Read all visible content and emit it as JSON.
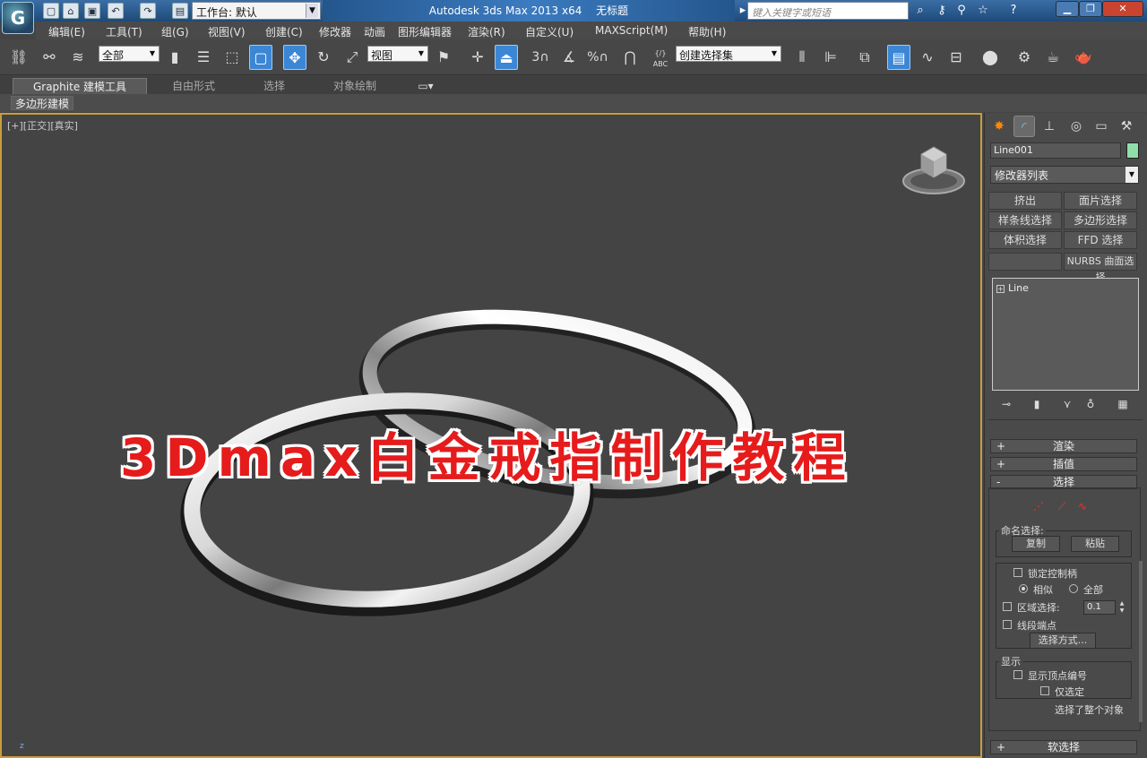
{
  "titlebar": {
    "workspace_label": "工作台: 默认",
    "app_name": "Autodesk 3ds Max  2013 x64",
    "doc_name": "无标题",
    "search_placeholder": "键入关键字或短语",
    "help_label": "?",
    "logo_glyph": "G"
  },
  "menu": {
    "items": [
      "编辑(E)",
      "工具(T)",
      "组(G)",
      "视图(V)",
      "创建(C)",
      "修改器",
      "动画",
      "图形编辑器",
      "渲染(R)",
      "自定义(U)",
      "MAXScript(M)",
      "帮助(H)"
    ]
  },
  "toolbar": {
    "selection_filter": "全部",
    "ref_coord": "视图",
    "snap_3": "3",
    "percent": "%",
    "named_selection": "创建选择集",
    "abc": "ABC"
  },
  "ribbon": {
    "tabs": [
      "Graphite 建模工具",
      "自由形式",
      "选择",
      "对象绘制"
    ],
    "panel_label": "多边形建模"
  },
  "viewport": {
    "label": "[+][正交][真实]",
    "overlay_title": "3Dmax白金戒指制作教程",
    "axis": "z"
  },
  "command_panel": {
    "object_name": "Line001",
    "object_color": "#8fe0a8",
    "modifier_list": "修改器列表",
    "modifier_buttons": [
      "挤出",
      "面片选择",
      "样条线选择",
      "多边形选择",
      "体积选择",
      "FFD 选择",
      "",
      "NURBS 曲面选择"
    ],
    "stack_item": "Line",
    "rollouts": {
      "render": "渲染",
      "interpolation": "插值",
      "selection": "选择",
      "soft_selection": "软选择"
    },
    "named_selection": {
      "title": "命名选择:",
      "copy": "复制",
      "paste": "粘贴"
    },
    "lock_handles": "锁定控制柄",
    "alike": "相似",
    "all": "全部",
    "area_selection": "区域选择:",
    "area_value": "0.1",
    "segment_end": "线段端点",
    "select_by": "选择方式...",
    "display": {
      "title": "显示",
      "show_vertex_numbers": "显示顶点编号",
      "selected_only": "仅选定"
    },
    "status": "选择了整个对象"
  }
}
